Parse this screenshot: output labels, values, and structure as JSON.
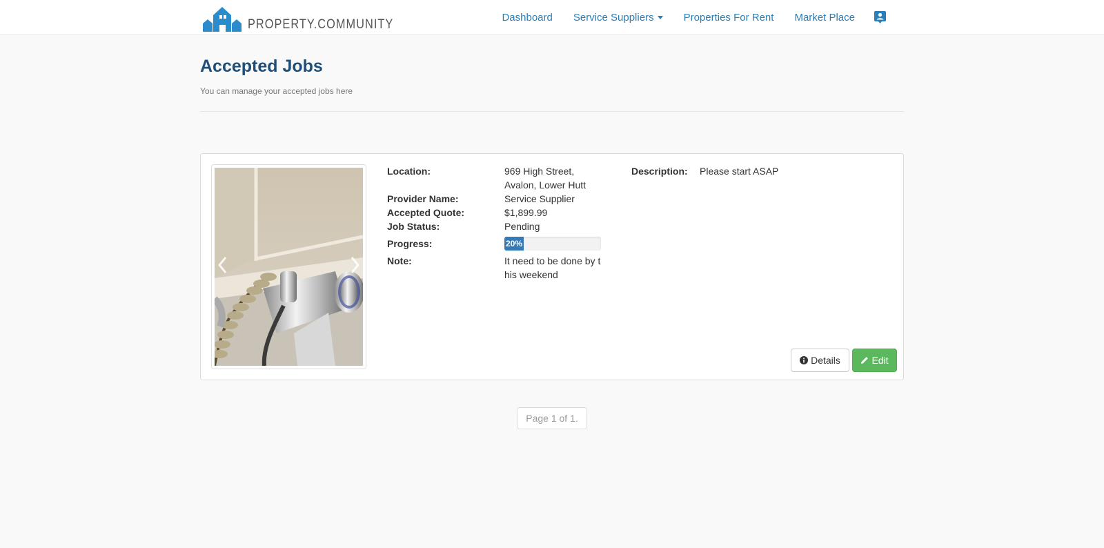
{
  "brand": {
    "name": "PROPERTY.COMMUNITY",
    "logo_icon": "house-logo-icon",
    "accent": "#2a8ccb"
  },
  "nav": {
    "items": [
      {
        "label": "Dashboard"
      },
      {
        "label": "Service Suppliers",
        "dropdown": true
      },
      {
        "label": "Properties For Rent"
      },
      {
        "label": "Market Place"
      }
    ],
    "profile_icon": "user-card-icon",
    "link_color": "#2a7fb8"
  },
  "header": {
    "title": "Accepted Jobs",
    "subtitle": "You can manage your accepted jobs here"
  },
  "job": {
    "photo_icon": "bathroom-tap-photo",
    "location_label": "Location:",
    "location_value": "969 High Street, Avalon, Lower Hutt",
    "provider_label": "Provider Name:",
    "provider_value": "Service Supplier",
    "quote_label": "Accepted Quote:",
    "quote_value": "$1,899.99",
    "status_label": "Job Status:",
    "status_value": "Pending",
    "progress_label": "Progress:",
    "progress_text": "20%",
    "progress_percent": 20,
    "note_label": "Note:",
    "note_value": "It need to be done by this weekend",
    "description_label": "Description:",
    "description_value": "Please start ASAP",
    "details_button": "Details",
    "edit_button": "Edit",
    "edit_color": "#5cb85c",
    "progress_color": "#337ab7"
  },
  "pagination": {
    "text": "Page 1 of 1."
  }
}
